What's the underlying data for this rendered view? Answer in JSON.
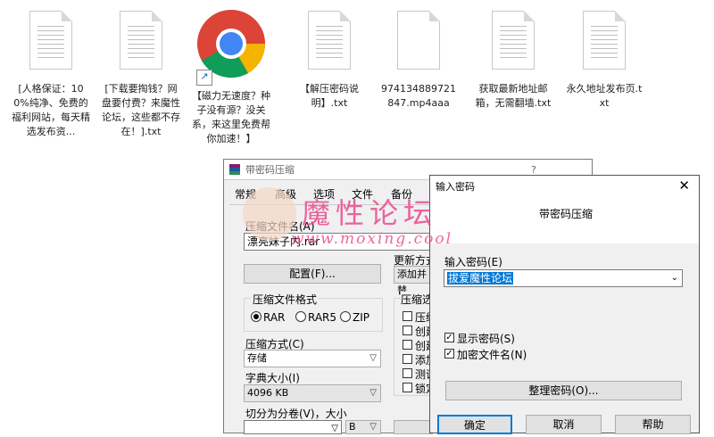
{
  "desktop": {
    "icons": [
      {
        "label": "[人格保证：100%纯净、免费的福利网站，每天精选发布资...",
        "type": "text"
      },
      {
        "label": "[下载要掏钱？网盘要付费？来魔性论坛，这些都不存在！].txt",
        "type": "text"
      },
      {
        "label": "【磁力无速度？种子没有源？没关系，来这里免费帮你加速！】",
        "type": "chrome"
      },
      {
        "label": "【解压密码说明】.txt",
        "type": "text"
      },
      {
        "label": "974134889721847.mp4aaa",
        "type": "text"
      },
      {
        "label": "获取最新地址邮箱，无需翻墙.txt",
        "type": "text"
      },
      {
        "label": "永久地址发布页.txt",
        "type": "text"
      }
    ]
  },
  "rar_window": {
    "title": "带密码压缩",
    "help_button": "?",
    "tabs": [
      "常规",
      "高级",
      "选项",
      "文件",
      "备份"
    ],
    "archive_name_label": "压缩文件名(A)",
    "archive_name_value": "漂亮妹子内.rar",
    "profile_button": "配置(F)...",
    "update_mode_label": "更新方式",
    "update_mode_value": "添加并替",
    "format_group_label": "压缩文件格式",
    "formats": [
      "RAR",
      "RAR5",
      "ZIP"
    ],
    "method_label": "压缩方式(C)",
    "method_value": "存储",
    "dict_label": "字典大小(I)",
    "dict_value": "4096 KB",
    "split_label": "切分为分卷(V)，大小",
    "split_unit": "B",
    "options_group_label": "压缩选",
    "options": [
      "压缩",
      "创建",
      "创建",
      "添加",
      "测试",
      "锁定"
    ]
  },
  "password_dialog": {
    "title": "输入密码",
    "subtitle": "带密码压缩",
    "password_label": "输入密码(E)",
    "password_value": "拔爱魔性论坛",
    "show_password_label": "显示密码(S)",
    "encrypt_names_label": "加密文件名(N)",
    "organize_button": "整理密码(O)...",
    "ok_button": "确定",
    "cancel_button": "取消",
    "help_button": "帮助"
  },
  "watermark": {
    "title": "魔性论坛",
    "url": "www.moxing.cool",
    "color": "#e94b8f"
  }
}
